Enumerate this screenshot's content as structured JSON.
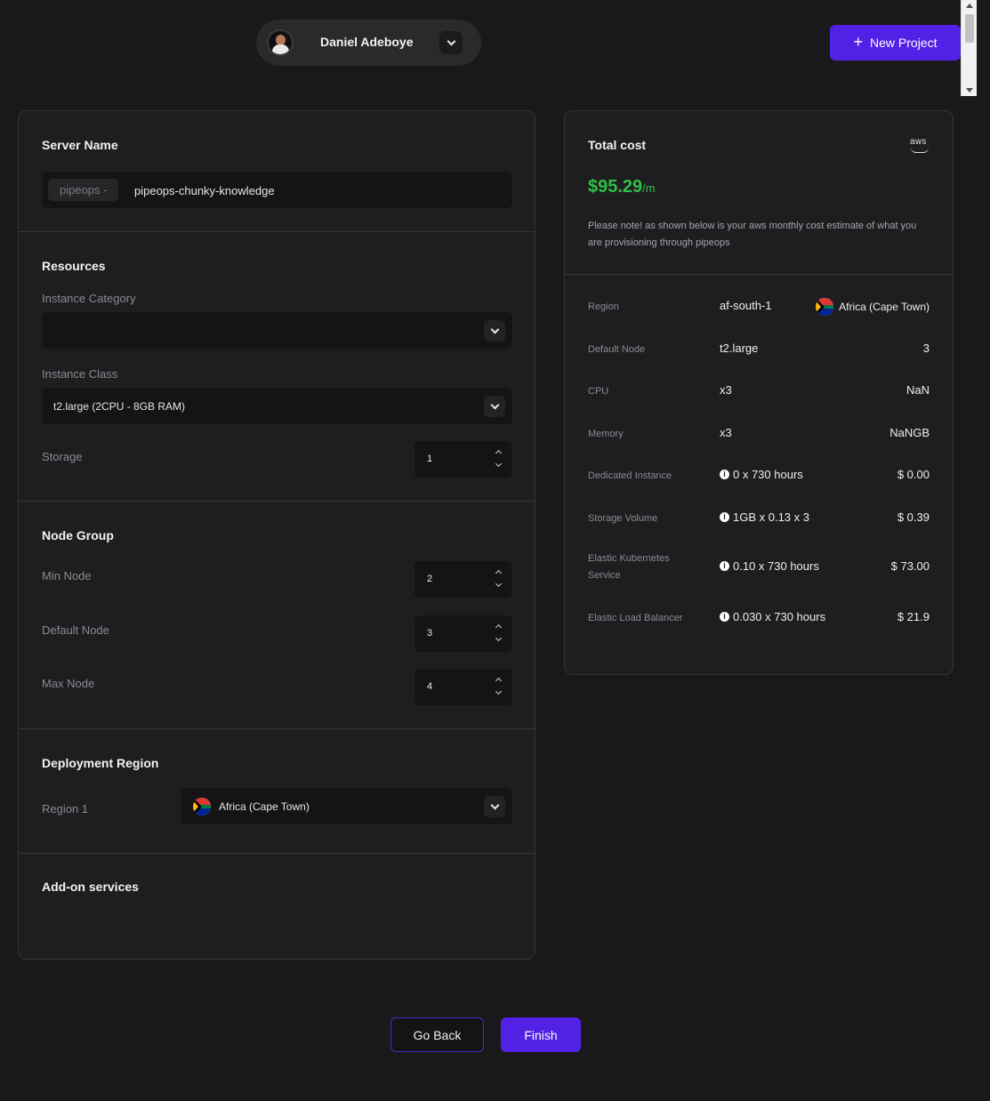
{
  "header": {
    "user_name": "Daniel Adeboye",
    "new_project_label": "New Project"
  },
  "server": {
    "title": "Server Name",
    "prefix": "pipeops -",
    "name": "pipeops-chunky-knowledge"
  },
  "resources": {
    "title": "Resources",
    "instance_category_label": "Instance Category",
    "instance_category_value": "",
    "instance_class_label": "Instance Class",
    "instance_class_value": "t2.large (2CPU - 8GB RAM)",
    "storage_label": "Storage",
    "storage_value": "1"
  },
  "node_group": {
    "title": "Node Group",
    "min_label": "Min Node",
    "min_value": "2",
    "default_label": "Default Node",
    "default_value": "3",
    "max_label": "Max Node",
    "max_value": "4"
  },
  "deployment": {
    "title": "Deployment Region",
    "region_label": "Region 1",
    "region_value": "Africa (Cape Town)"
  },
  "addons": {
    "title": "Add-on services"
  },
  "cost": {
    "title": "Total cost",
    "provider_icon": "aws-icon",
    "provider_text": "aws",
    "price": "$95.29",
    "price_unit": "/m",
    "price_color": "#2fbf45",
    "note": "Please note! as shown below is your aws monthly cost estimate of what you are provisioning through pipeops",
    "rows": [
      {
        "key": "Region",
        "mid": "af-south-1",
        "right": "Africa (Cape Town)"
      },
      {
        "key": "Default Node",
        "mid": "t2.large",
        "right": "3"
      },
      {
        "key": "CPU",
        "mid": "x3",
        "right": "NaN"
      },
      {
        "key": "Memory",
        "mid": "x3",
        "right": "NaNGB"
      },
      {
        "key": "Dedicated Instance",
        "mid": "0 x 730 hours",
        "right": "$ 0.00"
      },
      {
        "key": "Storage Volume",
        "mid": "1GB x 0.13 x 3",
        "right": "$ 0.39"
      },
      {
        "key": "Elastic Kubernetes Service",
        "mid": "0.10 x 730 hours",
        "right": "$ 73.00"
      },
      {
        "key": "Elastic Load Balancer",
        "mid": "0.030 x 730 hours",
        "right": "$ 21.9"
      }
    ]
  },
  "footer": {
    "back_label": "Go Back",
    "finish_label": "Finish"
  },
  "colors": {
    "accent": "#5221e6",
    "background": "#19191b",
    "panel": "#1e1e21"
  }
}
